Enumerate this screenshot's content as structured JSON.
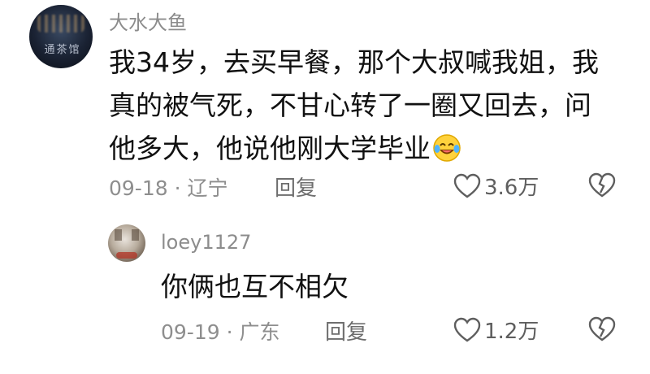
{
  "comments": [
    {
      "username": "大水大鱼",
      "avatar_text": "通茶馆",
      "lines": [
        "我34岁，去买早餐，那个大叔喊我姐，我",
        "真的被气死，不甘心转了一圈又回去，问",
        "他多大，他说他刚大学毕业"
      ],
      "emoji": "laughing-tears-emoji",
      "date_location": "09-18 · 辽宁",
      "reply_label": "回复",
      "likes": "3.6万"
    },
    {
      "username": "loey1127",
      "text": "你俩也互不相欠",
      "date_location": "09-19 · 广东",
      "reply_label": "回复",
      "likes": "1.2万"
    }
  ]
}
